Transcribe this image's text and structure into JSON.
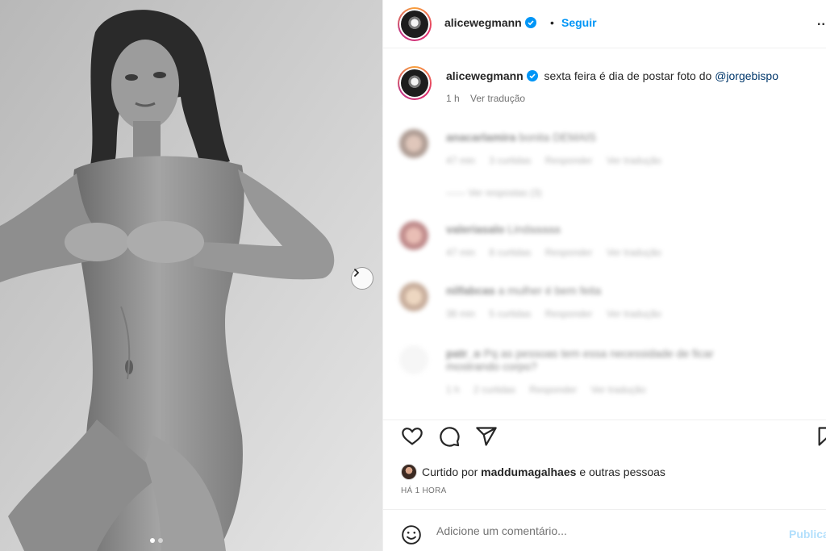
{
  "post": {
    "author": "alicewegmann",
    "follow_label": "Seguir",
    "separator": "•",
    "more_label": "..",
    "caption_text": "sexta feira é dia de postar foto do",
    "caption_mention": "@jorgebispo",
    "age": "1 h",
    "translate_label": "Ver tradução",
    "carousel_count": 2,
    "carousel_active": 1
  },
  "comments": [
    {
      "user": "anacarlamira",
      "text": "bonita DEMAIS",
      "age": "47 min",
      "likes": "3 curtidas",
      "reply": "Responder",
      "translate": "Ver tradução",
      "replies": "Ver respostas (3)"
    },
    {
      "user": "valeriasalo",
      "text": "Lindaaaaa",
      "age": "47 min",
      "likes": "8 curtidas",
      "reply": "Responder",
      "translate": "Ver tradução"
    },
    {
      "user": "nilfabcas",
      "text": "a mulher é bem feita",
      "age": "38 min",
      "likes": "5 curtidas",
      "reply": "Responder",
      "translate": "Ver tradução"
    },
    {
      "user": "patr_o",
      "text": "Pq as pessoas tem essa necessidade de ficar mostrando corpo?",
      "age": "1 h",
      "likes": "2 curtidas",
      "reply": "Responder",
      "translate": "Ver tradução"
    }
  ],
  "likes": {
    "prefix": "Curtido por",
    "user": "maddumagalhaes",
    "suffix": "e outras pessoas"
  },
  "timestamp": "HÁ 1 HORA",
  "comment_box": {
    "placeholder": "Adicione um comentário...",
    "publish_label": "Publicar"
  },
  "colors": {
    "accent": "#0095f6",
    "mention": "#00376b",
    "publish_disabled": "#b2dffc",
    "secondary_text": "#737373"
  },
  "icons": [
    "verified-badge-icon",
    "heart-icon",
    "comment-icon",
    "share-icon",
    "bookmark-icon",
    "emoji-icon",
    "chevron-right-icon"
  ]
}
